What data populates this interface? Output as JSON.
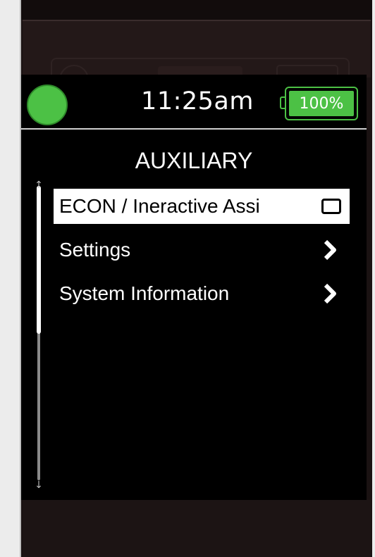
{
  "status_bar": {
    "time": "11:25am",
    "battery_percent": "100%",
    "battery_level": 1.0,
    "status_color": "#4cc145"
  },
  "menu": {
    "title": "AUXILIARY",
    "items": [
      {
        "label": "ECON / Ineractive Assi",
        "control": "checkbox",
        "checked": false,
        "selected": true
      },
      {
        "label": "Settings",
        "control": "chevron-right-icon",
        "selected": false
      },
      {
        "label": "System Information",
        "control": "chevron-right-icon",
        "selected": false
      }
    ]
  },
  "colors": {
    "accent": "#4cc145",
    "screen_bg": "#000000",
    "text": "#ffffff",
    "highlight_bg": "#ffffff"
  }
}
